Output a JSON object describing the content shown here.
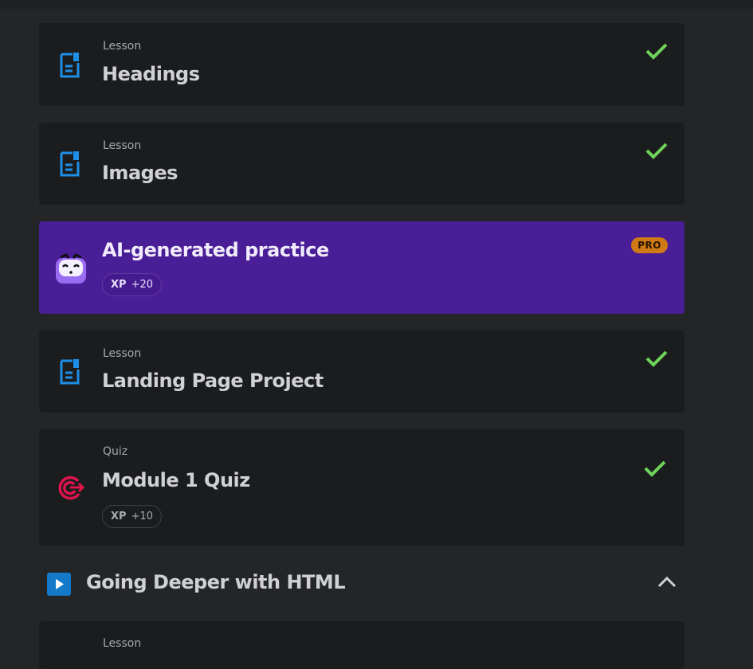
{
  "colors": {
    "background": "#242526",
    "card": "#1b1c1e",
    "ai_card": "#4a1e96",
    "check": "#6ed45a",
    "doc_icon": "#1e8fe6",
    "quiz_icon": "#e0144c",
    "pro_badge": "#cf7a15"
  },
  "items": [
    {
      "kind": "Lesson",
      "title": "Headings",
      "icon": "document-icon",
      "status": "completed"
    },
    {
      "kind": "Lesson",
      "title": "Images",
      "icon": "document-icon",
      "status": "completed"
    }
  ],
  "ai_practice": {
    "title": "AI-generated practice",
    "badge": "PRO",
    "xp_label": "XP",
    "xp_value": "+20",
    "icon": "robot-mascot-icon"
  },
  "items2": [
    {
      "kind": "Lesson",
      "title": "Landing Page Project",
      "icon": "document-icon",
      "status": "completed"
    },
    {
      "kind": "Quiz",
      "title": "Module 1 Quiz",
      "icon": "target-icon",
      "status": "completed",
      "xp_label": "XP",
      "xp_value": "+10"
    }
  ],
  "section": {
    "title": "Going Deeper with HTML",
    "icon": "play-icon",
    "expanded": true
  },
  "next_item": {
    "kind": "Lesson"
  }
}
